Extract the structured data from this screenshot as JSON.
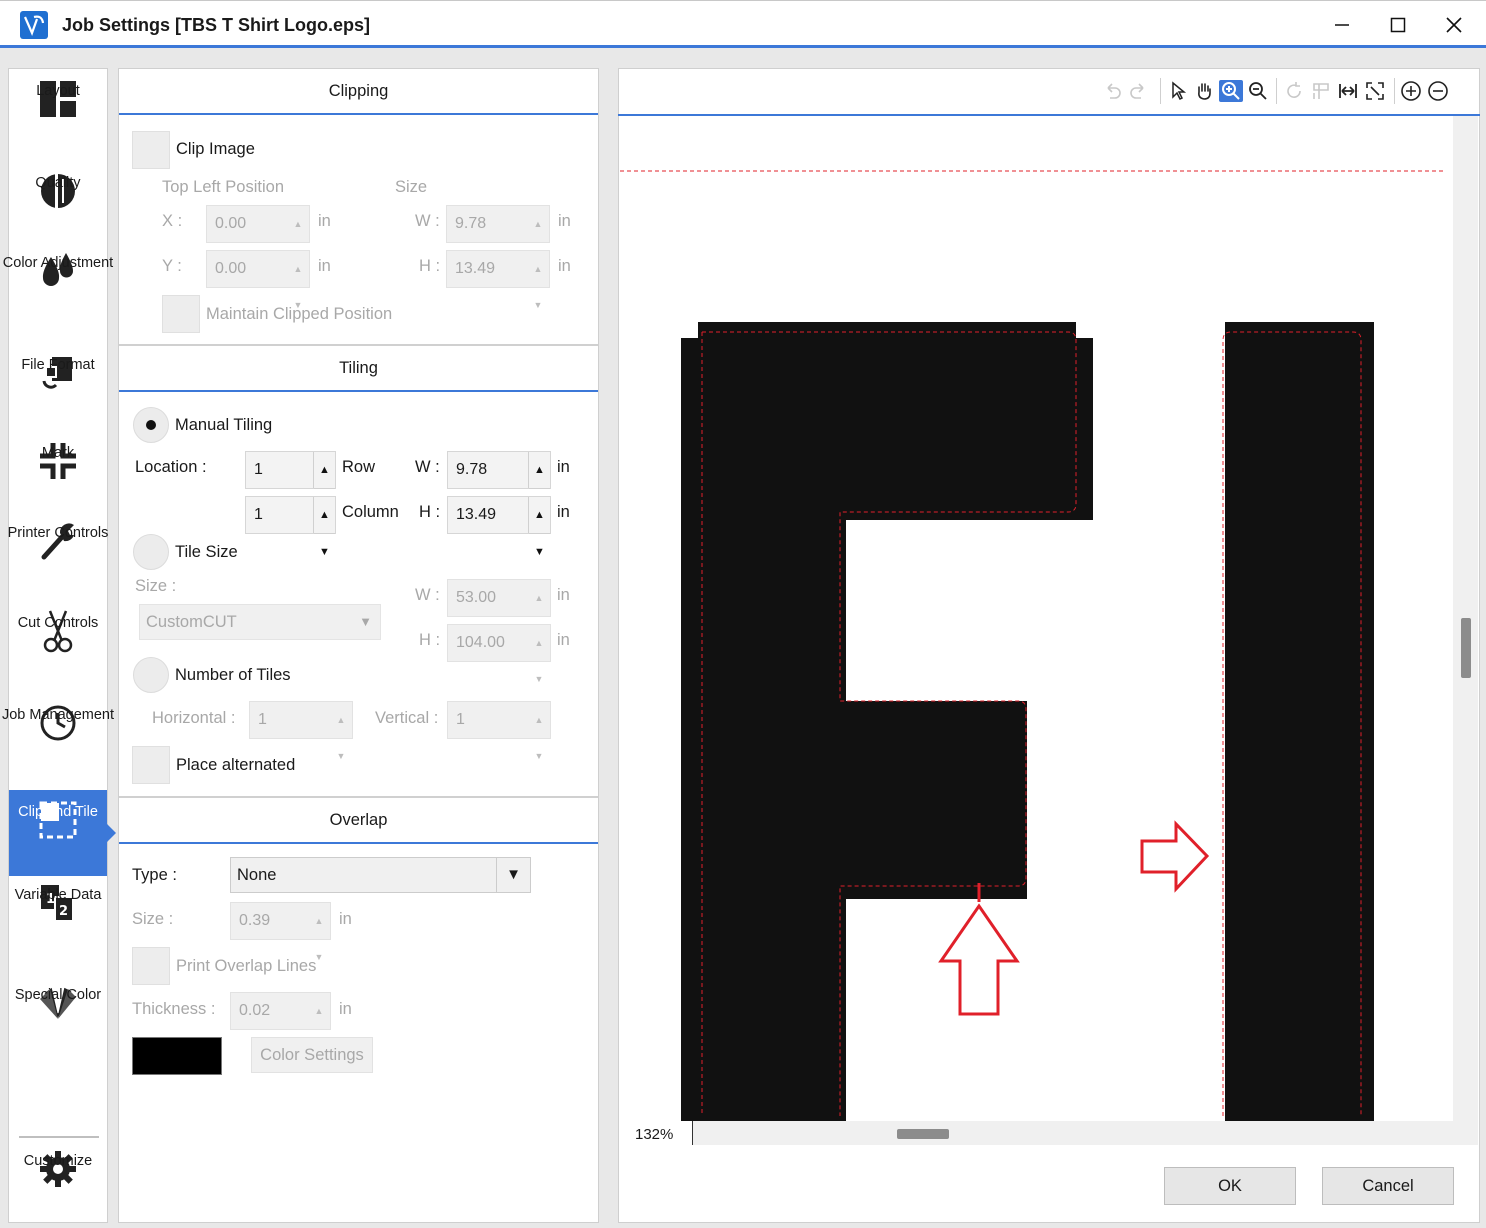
{
  "window": {
    "title": "Job Settings [TBS T Shirt Logo.eps]"
  },
  "sidebar": {
    "items": [
      {
        "label": "Layout",
        "icon": "layout-icon"
      },
      {
        "label": "Quality",
        "icon": "quality-icon"
      },
      {
        "label": "Color Adjustment",
        "icon": "color-drops-icon"
      },
      {
        "label": "File Format",
        "icon": "file-format-icon"
      },
      {
        "label": "Mark",
        "icon": "crop-mark-icon"
      },
      {
        "label": "Printer Controls",
        "icon": "wrench-icon"
      },
      {
        "label": "Cut Controls",
        "icon": "scissors-icon"
      },
      {
        "label": "Job Management",
        "icon": "clock-icon"
      },
      {
        "label": "Clip and Tile",
        "icon": "clip-tile-icon",
        "active": true
      },
      {
        "label": "Variable Data",
        "icon": "variable-data-icon"
      },
      {
        "label": "Special Color",
        "icon": "swatch-fan-icon"
      }
    ],
    "customize": {
      "label": "Customize",
      "icon": "gear-icon"
    }
  },
  "clipping": {
    "heading": "Clipping",
    "clip_image_label": "Clip Image",
    "top_left_label": "Top Left Position",
    "size_label": "Size",
    "x_label": "X :",
    "y_label": "Y :",
    "w_label": "W :",
    "h_label": "H :",
    "x_value": "0.00",
    "y_value": "0.00",
    "w_value": "9.78",
    "h_value": "13.49",
    "unit": "in",
    "maintain_label": "Maintain Clipped Position"
  },
  "tiling": {
    "heading": "Tiling",
    "manual_label": "Manual Tiling",
    "location_label": "Location :",
    "row_value": "1",
    "row_label": "Row",
    "column_value": "1",
    "column_label": "Column",
    "w_label": "W :",
    "h_label": "H :",
    "w_value": "9.78",
    "h_value": "13.49",
    "unit": "in",
    "tile_size_label": "Tile Size",
    "size_label": "Size :",
    "size_select": "CustomCUT",
    "tile_w_value": "53.00",
    "tile_h_value": "104.00",
    "num_tiles_label": "Number of Tiles",
    "horizontal_label": "Horizontal :",
    "horizontal_value": "1",
    "vertical_label": "Vertical :",
    "vertical_value": "1",
    "place_alt_label": "Place alternated"
  },
  "overlap": {
    "heading": "Overlap",
    "type_label": "Type :",
    "type_value": "None",
    "size_label": "Size :",
    "size_value": "0.39",
    "unit": "in",
    "print_lines_label": "Print Overlap Lines",
    "thickness_label": "Thickness :",
    "thickness_value": "0.02",
    "swatch_color": "#000000",
    "color_settings_label": "Color Settings"
  },
  "preview": {
    "zoom": "132%",
    "tools": [
      "undo-icon",
      "redo-icon",
      "pointer-icon",
      "hand-icon",
      "zoom-in-icon",
      "zoom-out-icon",
      "rotate-icon",
      "flip-icon",
      "fit-width-icon",
      "fit-page-icon",
      "add-icon",
      "remove-icon"
    ]
  },
  "footer": {
    "ok_label": "OK",
    "cancel_label": "Cancel"
  },
  "colors": {
    "accent": "#3c78d8",
    "cut_line": "#e0202a",
    "artwork": "#111111"
  }
}
